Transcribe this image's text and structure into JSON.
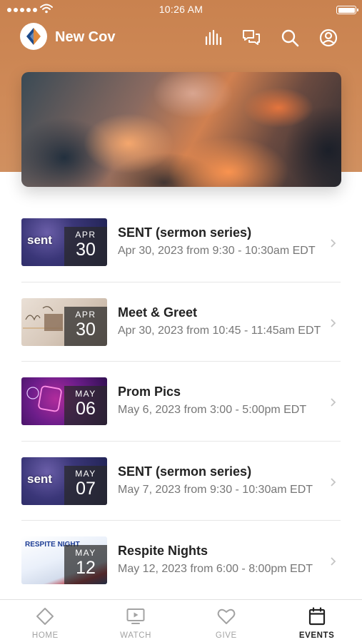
{
  "status_bar": {
    "time": "10:26 AM"
  },
  "header": {
    "app_title": "New Cov",
    "icons": [
      "audio-bars-icon",
      "chat-icon",
      "search-icon",
      "account-icon"
    ]
  },
  "colors": {
    "header_bg": "#cf8a58",
    "active_tab": "#222222",
    "inactive_tab": "#a3a3a3"
  },
  "events": [
    {
      "thumb": "sent",
      "thumb_text": "sent",
      "month": "APR",
      "day": "30",
      "title": "SENT (sermon series)",
      "subtitle": "Apr 30, 2023 from 9:30 - 10:30am EDT"
    },
    {
      "thumb": "meet",
      "thumb_text": "",
      "month": "APR",
      "day": "30",
      "title": "Meet & Greet",
      "subtitle": "Apr 30, 2023 from 10:45 - 11:45am EDT"
    },
    {
      "thumb": "prom",
      "thumb_text": "",
      "month": "MAY",
      "day": "06",
      "title": "Prom Pics",
      "subtitle": "May 6, 2023 from 3:00 - 5:00pm EDT"
    },
    {
      "thumb": "sent",
      "thumb_text": "sent",
      "month": "MAY",
      "day": "07",
      "title": "SENT (sermon series)",
      "subtitle": "May 7, 2023 from 9:30 - 10:30am EDT"
    },
    {
      "thumb": "respite",
      "thumb_text": "RESPITE NIGHT",
      "month": "MAY",
      "day": "12",
      "title": "Respite Nights",
      "subtitle": "May 12, 2023 from 6:00 - 8:00pm EDT"
    }
  ],
  "tabs": [
    {
      "label": "HOME",
      "icon": "diamond-icon",
      "active": false
    },
    {
      "label": "WATCH",
      "icon": "tv-play-icon",
      "active": false
    },
    {
      "label": "GIVE",
      "icon": "heart-icon",
      "active": false
    },
    {
      "label": "EVENTS",
      "icon": "calendar-icon",
      "active": true
    }
  ]
}
